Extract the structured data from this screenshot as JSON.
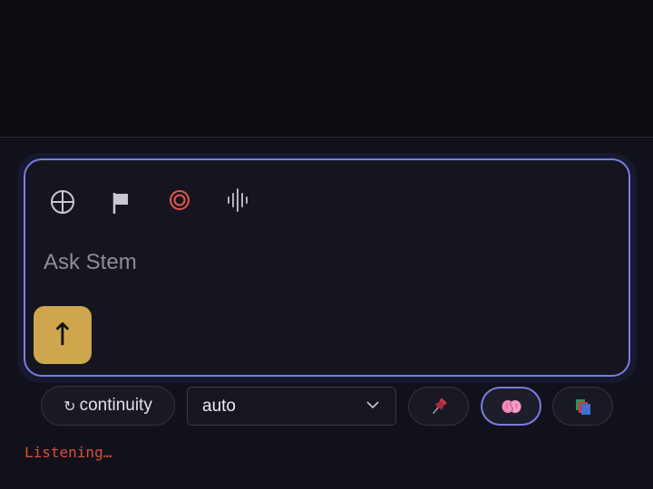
{
  "composer": {
    "placeholder": "Ask Stem",
    "send_glyph": "↑",
    "tools": [
      {
        "name": "crosshair-icon",
        "color": "#c8c8d0"
      },
      {
        "name": "flag-icon",
        "color": "#c8c8d0"
      },
      {
        "name": "record-icon",
        "color": "#e0574a"
      },
      {
        "name": "waveform-icon",
        "color": "#b4b4bc"
      }
    ]
  },
  "controls": {
    "continuity_glyph": "↻",
    "continuity_label": "continuity",
    "mode_select_value": "auto",
    "pin_icon": "pin-icon",
    "brain_icon": "brain-icon",
    "layers_icon": "layers-icon"
  },
  "status": {
    "text": "Listening…",
    "color": "#d9503a"
  },
  "colors": {
    "accent": "#7b7de0",
    "send": "#cda64e",
    "background": "#0c0c12"
  }
}
